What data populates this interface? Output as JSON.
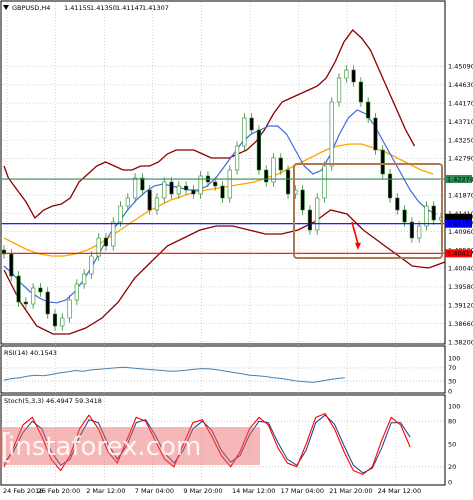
{
  "chart_data": [
    {
      "type": "line",
      "panel": "price",
      "header": {
        "symbol": "GBPUSD,H4",
        "ohlc": [
          "1.41155",
          "1.41350",
          "1.41147",
          "1.41307"
        ]
      },
      "ylim": [
        1.382,
        1.463
      ],
      "y_ticks": [
        "1.45090",
        "1.44630",
        "1.44170",
        "1.43710",
        "1.43250",
        "1.42790",
        "1.41870",
        "1.41410",
        "1.40960",
        "1.40500",
        "1.40040",
        "1.39580",
        "1.39120",
        "1.38660",
        "1.38200"
      ],
      "price_tags": [
        {
          "label": "1.42274",
          "value": 1.42274,
          "color": "#2e8b57"
        },
        {
          "label": "1.41307",
          "value": 1.41307,
          "color": "#000000"
        },
        {
          "label": "1.41157",
          "value": 1.41157,
          "color": "#0000ff"
        },
        {
          "label": "1.40417",
          "value": 1.40417,
          "color": "#ff0000"
        }
      ],
      "horizontal_lines": [
        {
          "value": 1.42274,
          "color": "#2e8b57"
        },
        {
          "value": 1.41157,
          "color": "#0000ff"
        },
        {
          "value": 1.40417,
          "color": "#ff0000"
        }
      ],
      "close": [
        1.404,
        1.3985,
        1.392,
        1.3915,
        1.3955,
        1.3945,
        1.389,
        1.386,
        1.388,
        1.3925,
        1.3965,
        1.399,
        1.4035,
        1.408,
        1.406,
        1.412,
        1.416,
        1.418,
        1.423,
        1.42,
        1.415,
        1.418,
        1.422,
        1.419,
        1.421,
        1.42,
        1.419,
        1.4235,
        1.422,
        1.421,
        1.418,
        1.425,
        1.431,
        1.438,
        1.435,
        1.425,
        1.422,
        1.428,
        1.425,
        1.419,
        1.42,
        1.415,
        1.41,
        1.418,
        1.426,
        1.442,
        1.448,
        1.45,
        1.447,
        1.442,
        1.438,
        1.43,
        1.424,
        1.418,
        1.415,
        1.412,
        1.408,
        1.411,
        1.416,
        1.4125,
        1.4131
      ],
      "bands": {
        "upper": [
          1.426,
          1.423,
          1.42,
          1.417,
          1.413,
          1.415,
          1.416,
          1.4165,
          1.418,
          1.422,
          1.424,
          1.426,
          1.427,
          1.426,
          1.425,
          1.425,
          1.426,
          1.426,
          1.427,
          1.429,
          1.43,
          1.43,
          1.43,
          1.429,
          1.428,
          1.428,
          1.428,
          1.429,
          1.43,
          1.432,
          1.435,
          1.439,
          1.442,
          1.443,
          1.444,
          1.445,
          1.446,
          1.448,
          1.452,
          1.457,
          1.46,
          1.458,
          1.455,
          1.45,
          1.445,
          1.44,
          1.435,
          1.431
        ],
        "upper_x": [
          0,
          1,
          3,
          5,
          7,
          9,
          11,
          13,
          15,
          17,
          19,
          21,
          23,
          25,
          27,
          29,
          31,
          33,
          35,
          37,
          39,
          41,
          43,
          45,
          47,
          49,
          51,
          53,
          55,
          57,
          59,
          61,
          63,
          65,
          67,
          69,
          71,
          73,
          75,
          77,
          79,
          81,
          83,
          85,
          87,
          89,
          91,
          93
        ],
        "lower": [
          1.4,
          1.392,
          1.386,
          1.384,
          1.384,
          1.3855,
          1.388,
          1.392,
          1.398,
          1.402,
          1.406,
          1.408,
          1.41,
          1.411,
          1.411,
          1.41,
          1.409,
          1.409,
          1.41,
          1.412,
          1.415,
          1.414,
          1.41,
          1.407,
          1.404,
          1.401,
          1.4005,
          1.402
        ]
      },
      "ma_fast": [
        1.401,
        1.399,
        1.3965,
        1.3945,
        1.393,
        1.392,
        1.3918,
        1.3925,
        1.3945,
        1.3975,
        1.401,
        1.405,
        1.409,
        1.412,
        1.415,
        1.4175,
        1.4195,
        1.421,
        1.4215,
        1.421,
        1.4205,
        1.42,
        1.42,
        1.421,
        1.423,
        1.426,
        1.429,
        1.432,
        1.434,
        1.435,
        1.436,
        1.436,
        1.434,
        1.43,
        1.426,
        1.424,
        1.425,
        1.429,
        1.434,
        1.438,
        1.44,
        1.439,
        1.436,
        1.432,
        1.428,
        1.424,
        1.42,
        1.417,
        1.415,
        1.414
      ],
      "ma_slow": [
        1.408,
        1.4065,
        1.405,
        1.404,
        1.4035,
        1.4035,
        1.404,
        1.405,
        1.4065,
        1.4085,
        1.4105,
        1.4125,
        1.4145,
        1.416,
        1.4175,
        1.4185,
        1.4195,
        1.42,
        1.4205,
        1.421,
        1.4215,
        1.422,
        1.423,
        1.424,
        1.4255,
        1.427,
        1.4285,
        1.43,
        1.431,
        1.4315,
        1.4315,
        1.4305,
        1.4295,
        1.428,
        1.4265,
        1.425,
        1.424
      ],
      "colors": {
        "candles": "#2e8b2e",
        "bands": "#8b0000",
        "ma_fast": "#4169e1",
        "ma_slow": "#ffa500"
      }
    },
    {
      "type": "line",
      "panel": "rsi",
      "header": "RSI(14) 40.1543",
      "ylim": [
        0,
        100
      ],
      "y_ticks": [
        "100",
        "70",
        "30",
        "0"
      ],
      "levels": [
        70,
        30
      ],
      "values": [
        33,
        38,
        40,
        45,
        48,
        46,
        50,
        55,
        58,
        62,
        60,
        64,
        66,
        68,
        70,
        72,
        70,
        68,
        66,
        64,
        62,
        60,
        61,
        63,
        66,
        68,
        67,
        64,
        60,
        56,
        52,
        48,
        46,
        44,
        40,
        38,
        34,
        30,
        28,
        26,
        30,
        34,
        38,
        40
      ],
      "color": "#4682b4"
    },
    {
      "type": "line",
      "panel": "stochastic",
      "header": "Stoch(5,3,3) 46.4947 59.3418",
      "ylim": [
        0,
        100
      ],
      "y_ticks": [
        "100",
        "80",
        "50",
        "20",
        "0"
      ],
      "levels": [
        80,
        20
      ],
      "main": [
        20,
        45,
        75,
        85,
        60,
        30,
        15,
        35,
        70,
        88,
        70,
        40,
        25,
        55,
        85,
        80,
        55,
        30,
        20,
        50,
        78,
        82,
        60,
        35,
        20,
        40,
        70,
        85,
        75,
        45,
        25,
        20,
        50,
        85,
        90,
        70,
        40,
        15,
        10,
        20,
        55,
        85,
        75,
        46
      ],
      "signal": [
        25,
        40,
        65,
        80,
        70,
        40,
        22,
        30,
        60,
        82,
        78,
        50,
        30,
        48,
        78,
        82,
        62,
        38,
        25,
        42,
        70,
        80,
        68,
        42,
        26,
        35,
        62,
        80,
        78,
        52,
        30,
        22,
        42,
        78,
        88,
        76,
        48,
        22,
        12,
        18,
        45,
        78,
        78,
        59
      ],
      "colors": {
        "main": "#ff0000",
        "signal": "#1e3a8a"
      }
    }
  ],
  "x_labels": [
    "24 Feb 2016",
    "26 Feb 20:00",
    "2 Mar 12:00",
    "7 Mar 04:00",
    "9 Mar 20:00",
    "14 Mar 12:00",
    "17 Mar 04:00",
    "21 Mar 20:00",
    "24 Mar 12:00"
  ],
  "watermark": "instaforex.com"
}
